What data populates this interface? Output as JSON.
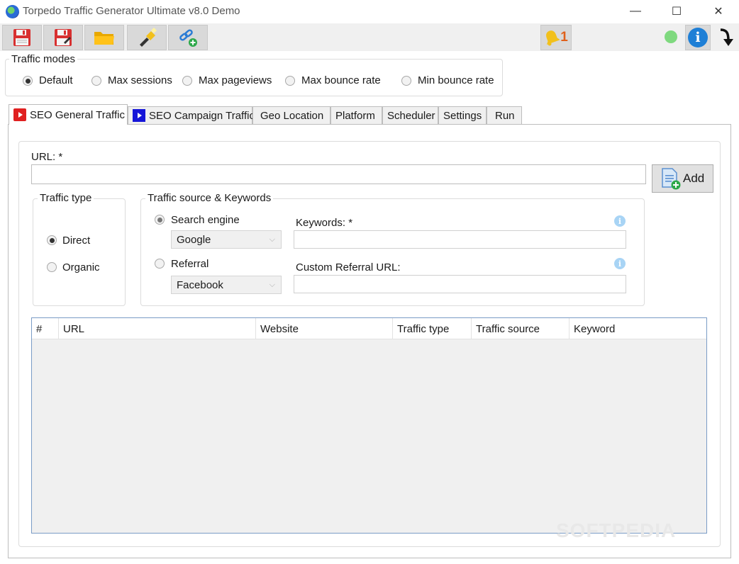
{
  "window": {
    "title": "Torpedo Traffic Generator Ultimate v8.0 Demo",
    "minimize": "—",
    "maximize": "☐",
    "close": "✕"
  },
  "toolbar": {
    "buttons": [
      {
        "icon": "save-icon"
      },
      {
        "icon": "save-as-icon"
      },
      {
        "icon": "open-folder-icon"
      },
      {
        "icon": "flashlight-icon"
      },
      {
        "icon": "add-link-icon"
      }
    ],
    "notifications": {
      "icon": "bell-icon",
      "count": "1"
    },
    "status_color": "#7fd97f",
    "info_label": "i"
  },
  "traffic_modes": {
    "label": "Traffic modes",
    "options": [
      {
        "label": "Default",
        "selected": true
      },
      {
        "label": "Max sessions",
        "selected": false
      },
      {
        "label": "Max pageviews",
        "selected": false
      },
      {
        "label": "Max bounce rate",
        "selected": false
      },
      {
        "label": "Min bounce rate",
        "selected": false
      }
    ]
  },
  "tabs": [
    {
      "label": "SEO General Traffic",
      "active": true,
      "icon_color": "#e02020"
    },
    {
      "label": "SEO Campaign Traffic",
      "active": false,
      "icon_color": "#1515d8"
    },
    {
      "label": "Geo Location",
      "active": false
    },
    {
      "label": "Platform",
      "active": false
    },
    {
      "label": "Scheduler",
      "active": false
    },
    {
      "label": "Settings",
      "active": false
    },
    {
      "label": "Run",
      "active": false
    }
  ],
  "form": {
    "url_label": "URL: *",
    "url_value": "",
    "add_label": "Add",
    "traffic_type": {
      "label": "Traffic type",
      "options": [
        {
          "label": "Direct",
          "selected": true
        },
        {
          "label": "Organic",
          "selected": false
        }
      ]
    },
    "traffic_source": {
      "label": "Traffic source & Keywords",
      "search_engine_label": "Search engine",
      "search_engine_value": "Google",
      "referral_label": "Referral",
      "referral_value": "Facebook",
      "keywords_label": "Keywords: *",
      "keywords_value": "",
      "custom_referral_label": "Custom Referral URL:",
      "custom_referral_value": ""
    }
  },
  "table": {
    "columns": [
      "#",
      "URL",
      "Website",
      "Traffic type",
      "Traffic source",
      "Keyword"
    ],
    "rows": []
  },
  "watermark": "SOFTPEDIA"
}
